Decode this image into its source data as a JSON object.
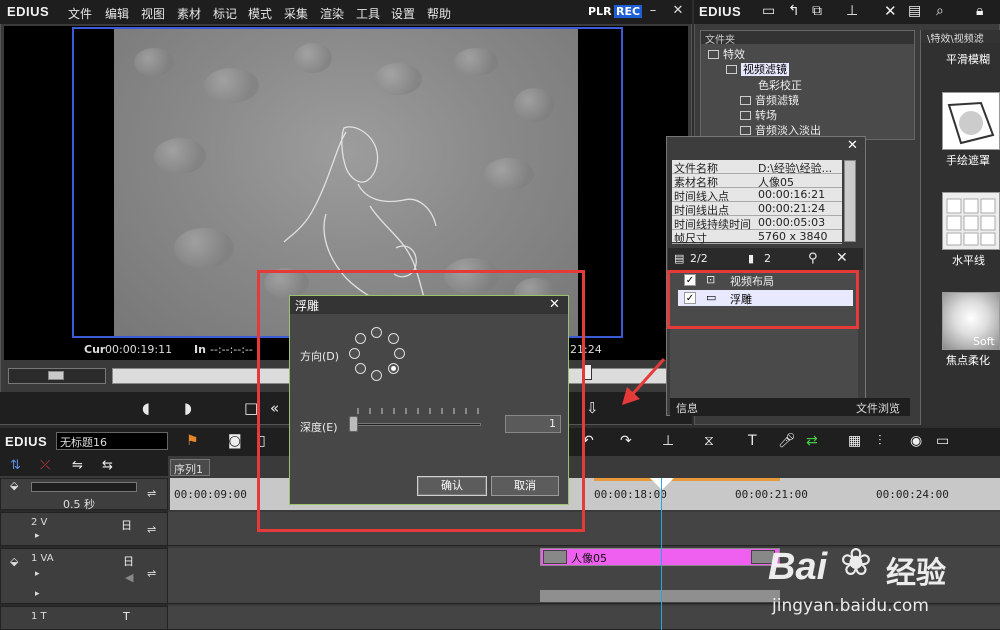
{
  "app": {
    "name": "EDIUS"
  },
  "menu": [
    "文件",
    "编辑",
    "视图",
    "素材",
    "标记",
    "模式",
    "采集",
    "渲染",
    "工具",
    "设置",
    "帮助"
  ],
  "player": {
    "plr": "PLR",
    "rec": "REC",
    "cur_label": "Cur",
    "cur_value": "00:00:19:11",
    "in_label": "In",
    "in_value": "--:--:--:--",
    "right_tc": "21:24"
  },
  "bin": {
    "title": "EDIUS",
    "folder_header": "文件夹",
    "path_header": "\\特效\\视频滤",
    "tree": [
      "特效",
      "视频滤镜",
      "色彩校正",
      "音频滤镜",
      "转场",
      "音频淡入淡出"
    ],
    "effects": [
      "平滑模糊",
      "手绘遮罩",
      "水平线",
      "焦点柔化"
    ],
    "soft_label": "Soft"
  },
  "info": {
    "rows": [
      {
        "k": "文件名称",
        "v": "D:\\经验\\经验..."
      },
      {
        "k": "素材名称",
        "v": "人像05"
      },
      {
        "k": "时间线入点",
        "v": "00:00:16:21"
      },
      {
        "k": "时间线出点",
        "v": "00:00:21:24"
      },
      {
        "k": "时间线持续时间",
        "v": "00:00:05:03"
      },
      {
        "k": "帧尺寸",
        "v": "5760 x 3840"
      }
    ],
    "layer_count": "2/2",
    "key_count": "2",
    "layers": [
      {
        "name": "视频布局",
        "checked": true
      },
      {
        "name": "浮雕",
        "checked": true
      }
    ],
    "tab_info": "信息",
    "tab_browse": "文件浏览"
  },
  "timeline": {
    "app": "EDIUS",
    "project": "无标题16",
    "sequence": "序列1",
    "zoom": "0.5 秒",
    "ticks": [
      "00:00:09:00",
      "00:00:18:00",
      "00:00:21:00",
      "00:00:24:00"
    ],
    "tracks": [
      {
        "name": "2 V",
        "icon": "日"
      },
      {
        "name": "1 VA",
        "icon": "日"
      },
      {
        "name": "1 T",
        "icon": "T"
      }
    ],
    "clip": "人像05"
  },
  "dialog": {
    "title": "浮雕",
    "direction_label": "方向(D)",
    "depth_label": "深度(E)",
    "depth_value": "1",
    "ok": "确认",
    "cancel": "取消"
  },
  "watermark": {
    "brand": "Bai",
    "mark": "经验",
    "url": "jingyan.baidu.com"
  },
  "colors": {
    "accent_rec": "#1e5fd8",
    "annotation": "#e53a3a",
    "clip": "#f060f0"
  }
}
